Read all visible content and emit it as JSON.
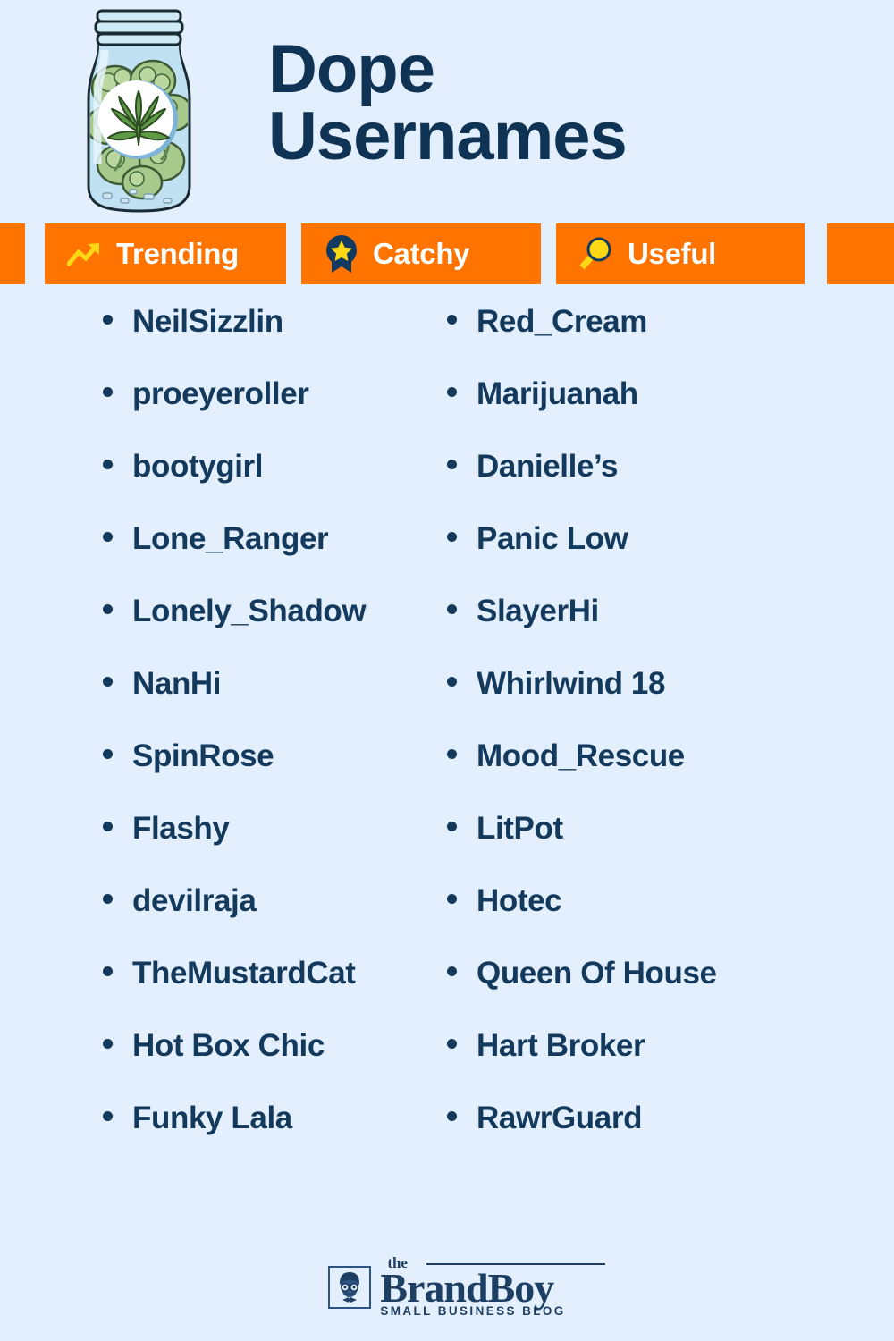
{
  "theme": {
    "background": "#e3effc",
    "accent_orange": "#ff7300",
    "navy": "#13395c",
    "title_navy": "#0f3354",
    "badge_text": "#ffffff",
    "icon_yellow": "#ffd814"
  },
  "header": {
    "title_line1": "Dope",
    "title_line2": "Usernames",
    "illustration": "cannabis-jar-illustration"
  },
  "badges": [
    {
      "label": "Trending",
      "icon": "trending-up-icon"
    },
    {
      "label": "Catchy",
      "icon": "award-star-icon"
    },
    {
      "label": "Useful",
      "icon": "magnifying-glass-icon"
    }
  ],
  "list": {
    "left_column": [
      "NeilSizzlin",
      "proeyeroller",
      "bootygirl",
      "Lone_Ranger",
      "Lonely_Shadow",
      "NanHi",
      "SpinRose",
      "Flashy",
      "devilraja",
      "TheMustardCat",
      "Hot Box Chic",
      "Funky Lala"
    ],
    "right_column": [
      "Red_Cream",
      "Marijuanah",
      "Danielle’s",
      "Panic Low",
      "SlayerHi",
      "Whirlwind 18",
      "Mood_Rescue",
      "LitPot",
      "Hotec",
      "Queen Of House",
      "Hart Broker",
      "RawrGuard"
    ]
  },
  "footer": {
    "logo_the": "the",
    "logo_brand": "BrandBoy",
    "logo_tagline": "SMALL BUSINESS BLOG",
    "logo_icon": "boy-avatar-icon"
  }
}
